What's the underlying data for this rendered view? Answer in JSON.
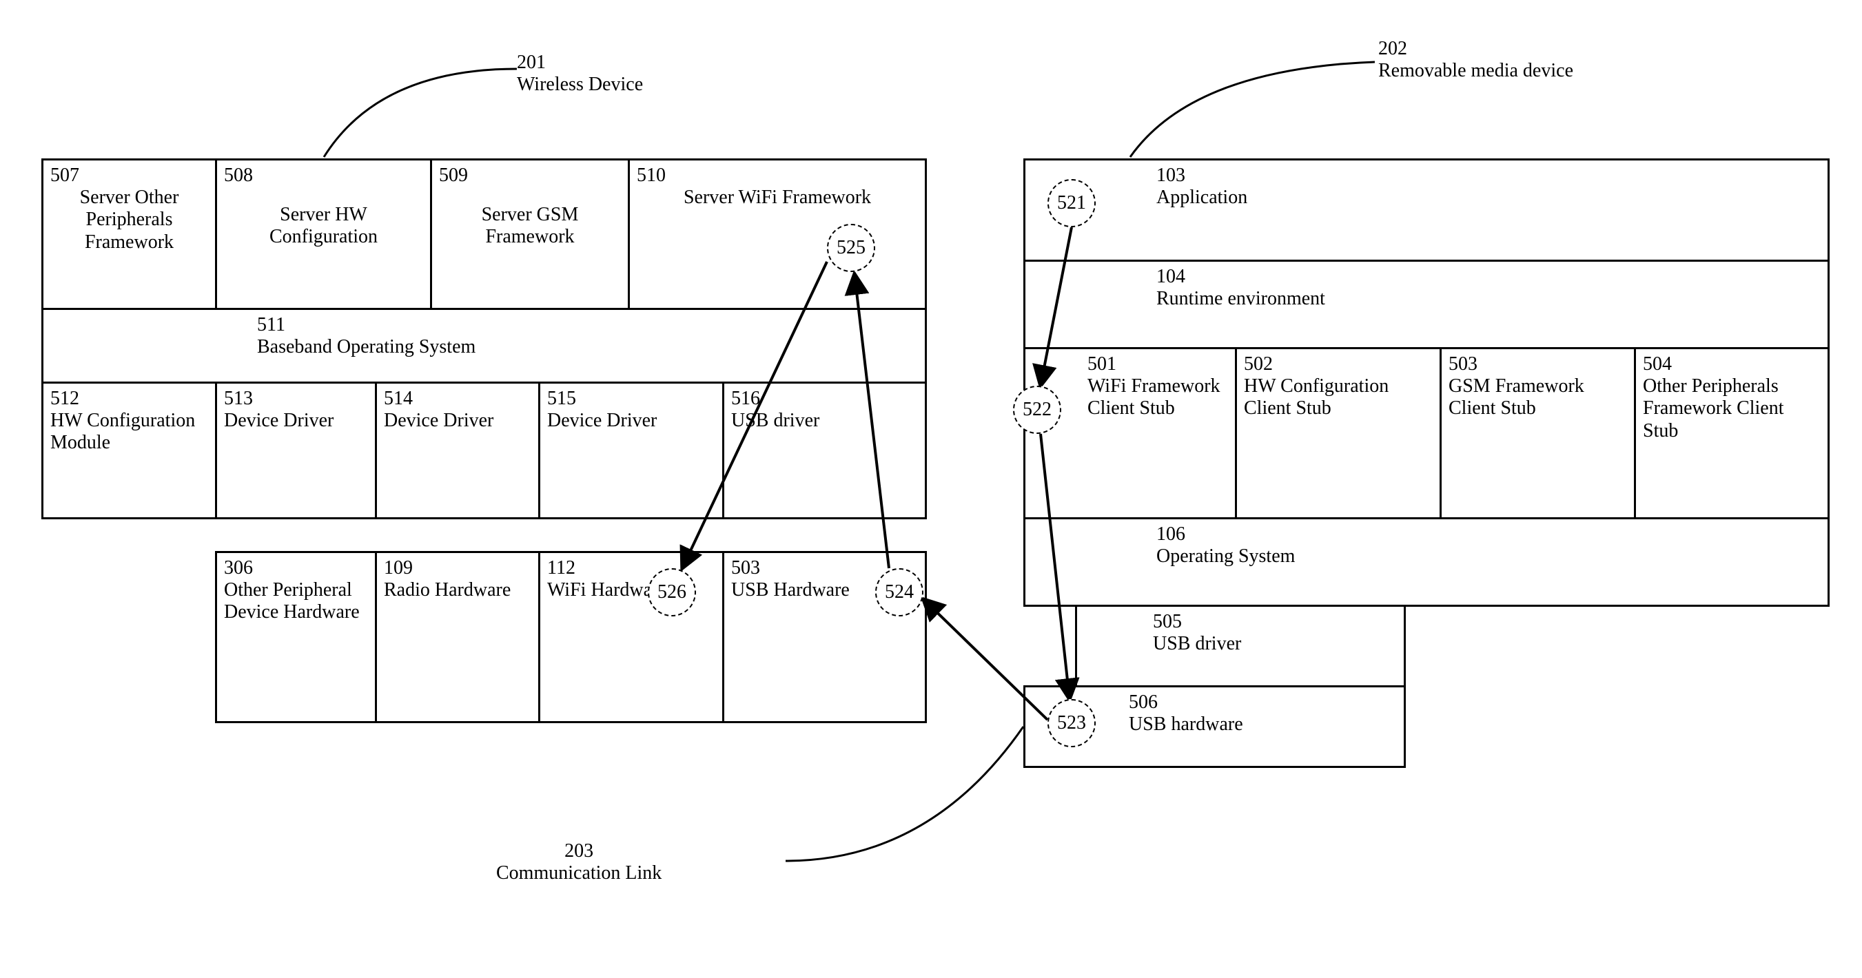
{
  "callout_wireless": {
    "num": "201",
    "text": "Wireless Device"
  },
  "callout_media": {
    "num": "202",
    "text": "Removable media device"
  },
  "callout_comm": {
    "num": "203",
    "text": "Communication Link"
  },
  "left": {
    "b507": {
      "num": "507",
      "text": "Server Other Peripherals Framework"
    },
    "b508": {
      "num": "508",
      "text": "Server HW Configuration"
    },
    "b509": {
      "num": "509",
      "text": "Server GSM Framework"
    },
    "b510": {
      "num": "510",
      "text": "Server WiFi Framework"
    },
    "b511": {
      "num": "511",
      "text": "Baseband Operating System"
    },
    "b512": {
      "num": "512",
      "text": "HW Configuration Module"
    },
    "b513": {
      "num": "513",
      "text": "Device Driver"
    },
    "b514": {
      "num": "514",
      "text": "Device Driver"
    },
    "b515": {
      "num": "515",
      "text": "Device Driver"
    },
    "b516": {
      "num": "516",
      "text": "USB driver"
    },
    "b306": {
      "num": "306",
      "text": "Other Peripheral Device Hardware"
    },
    "b109": {
      "num": "109",
      "text": "Radio Hardware"
    },
    "b112": {
      "num": "112",
      "text": "WiFi Hardware"
    },
    "b503hw": {
      "num": "503",
      "text": "USB Hardware"
    }
  },
  "right": {
    "b103": {
      "num": "103",
      "text": "Application"
    },
    "b104": {
      "num": "104",
      "text": "Runtime environment"
    },
    "b501": {
      "num": "501",
      "text": "WiFi Framework Client Stub"
    },
    "b502": {
      "num": "502",
      "text": "HW Configuration Client Stub"
    },
    "b503": {
      "num": "503",
      "text": "GSM Framework Client Stub"
    },
    "b504": {
      "num": "504",
      "text": "Other Peripherals Framework Client Stub"
    },
    "b106": {
      "num": "106",
      "text": "Operating System"
    },
    "b505": {
      "num": "505",
      "text": "USB driver"
    },
    "b506": {
      "num": "506",
      "text": "USB hardware"
    }
  },
  "circles": {
    "c521": "521",
    "c522": "522",
    "c523": "523",
    "c524": "524",
    "c525": "525",
    "c526": "526"
  }
}
